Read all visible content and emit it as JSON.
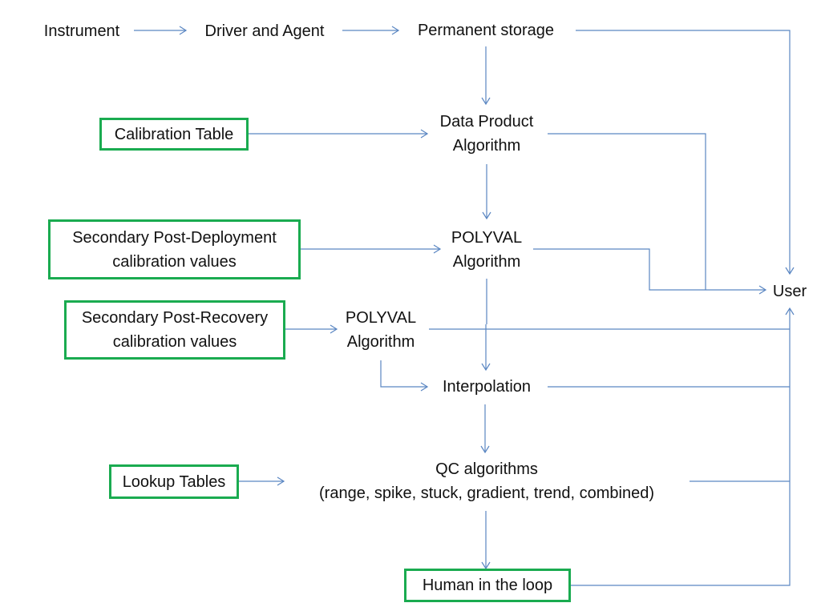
{
  "colors": {
    "connector": "#5a86c2",
    "input_box_border": "#1aab50"
  },
  "nodes": {
    "instrument": "Instrument",
    "driver_agent": "Driver and  Agent",
    "permanent_storage": "Permanent storage",
    "data_product": [
      "Data Product",
      "Algorithm"
    ],
    "calibration_table": "Calibration Table",
    "polyval_1": [
      "POLYVAL",
      "Algorithm"
    ],
    "secondary_post_deployment": [
      "Secondary Post-Deployment",
      "calibration values"
    ],
    "user": "User",
    "secondary_post_recovery": [
      "Secondary Post-Recovery",
      "calibration values"
    ],
    "polyval_2": [
      "POLYVAL",
      "Algorithm"
    ],
    "interpolation": "Interpolation",
    "qc_algorithms": [
      "QC algorithms",
      "(range, spike, stuck, gradient, trend, combined)"
    ],
    "lookup_tables": "Lookup Tables",
    "human_in_loop": "Human in the loop"
  }
}
